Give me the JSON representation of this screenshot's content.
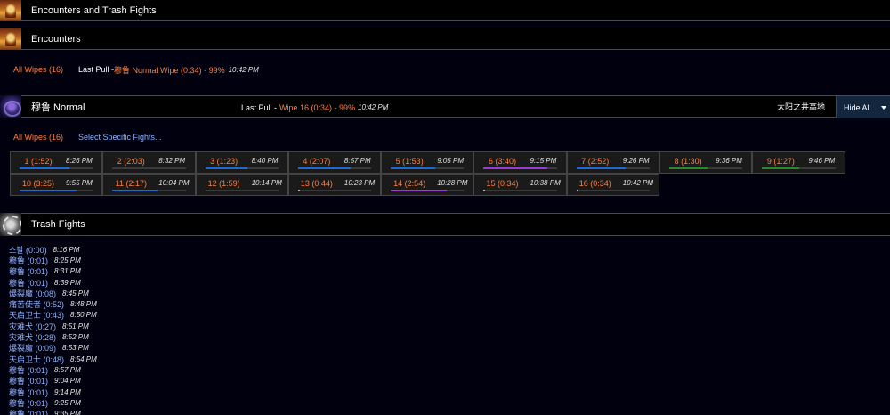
{
  "top_header": {
    "title": "Encounters and Trash Fights"
  },
  "encounters_header": {
    "title": "Encounters"
  },
  "summary": {
    "all_wipes": "All Wipes (16)",
    "last_pull_label": "Last Pull - ",
    "last_pull_value": "穆鲁 Normal Wipe (0:34) - 99%",
    "last_pull_time": "10:42 PM"
  },
  "boss": {
    "title": "穆鲁 Normal",
    "last_pull_label": "Last Pull - ",
    "last_pull_value": "Wipe 16 (0:34) - 99%",
    "last_pull_time": "10:42 PM",
    "zone": "太阳之井高地",
    "hide_all": "Hide All",
    "all_wipes": "All Wipes (16)",
    "select_fights": "Select Specific Fights..."
  },
  "colors": {
    "accent_orange": "#ff7f3f",
    "link_blue": "#8fb3ff",
    "bar_blue": "#1e6ad8",
    "bar_purple": "#9a3ad8",
    "bar_green": "#2a8a2a",
    "bar_gray": "#bdbdbd"
  },
  "fights": [
    {
      "label": "1 (1:52)",
      "time": "8:26 PM",
      "progress": 0.68,
      "color": "#1e6ad8"
    },
    {
      "label": "2 (2:03)",
      "time": "8:32 PM",
      "progress": 0.0,
      "color": "#1e6ad8"
    },
    {
      "label": "3 (1:23)",
      "time": "8:40 PM",
      "progress": 0.58,
      "color": "#1e6ad8"
    },
    {
      "label": "4 (2:07)",
      "time": "8:57 PM",
      "progress": 0.72,
      "color": "#1e6ad8"
    },
    {
      "label": "5 (1:53)",
      "time": "9:05 PM",
      "progress": 0.6,
      "color": "#1e6ad8"
    },
    {
      "label": "6 (3:40)",
      "time": "9:15 PM",
      "progress": 0.87,
      "color": "#9a3ad8"
    },
    {
      "label": "7 (2:52)",
      "time": "9:26 PM",
      "progress": 0.67,
      "color": "#1e6ad8"
    },
    {
      "label": "8 (1:30)",
      "time": "9:36 PM",
      "progress": 0.52,
      "color": "#2a8a2a"
    },
    {
      "label": "9 (1:27)",
      "time": "9:46 PM",
      "progress": 0.5,
      "color": "#2a8a2a"
    },
    {
      "label": "10 (3:25)",
      "time": "9:55 PM",
      "progress": 0.78,
      "color": "#1e6ad8"
    },
    {
      "label": "11 (2:17)",
      "time": "10:04 PM",
      "progress": 0.62,
      "color": "#1e6ad8"
    },
    {
      "label": "12 (1:59)",
      "time": "10:14 PM",
      "progress": 0.0,
      "color": "#1e6ad8"
    },
    {
      "label": "13 (0:44)",
      "time": "10:23 PM",
      "progress": 0.02,
      "color": "#bdbdbd"
    },
    {
      "label": "14 (2:54)",
      "time": "10:28 PM",
      "progress": 0.76,
      "color": "#9a3ad8"
    },
    {
      "label": "15 (0:34)",
      "time": "10:38 PM",
      "progress": 0.02,
      "color": "#bdbdbd"
    },
    {
      "label": "16 (0:34)",
      "time": "10:42 PM",
      "progress": 0.02,
      "color": "#bdbdbd"
    }
  ],
  "trash_header": {
    "title": "Trash Fights"
  },
  "trash": [
    {
      "name": "스팔 (0:00)",
      "time": "8:16 PM"
    },
    {
      "name": "穆鲁 (0:01)",
      "time": "8:25 PM"
    },
    {
      "name": "穆鲁 (0:01)",
      "time": "8:31 PM"
    },
    {
      "name": "穆鲁 (0:01)",
      "time": "8:39 PM"
    },
    {
      "name": "爆裂魔 (0:08)",
      "time": "8:45 PM"
    },
    {
      "name": "痛苦使者 (0:52)",
      "time": "8:48 PM"
    },
    {
      "name": "天启卫士 (0:43)",
      "time": "8:50 PM"
    },
    {
      "name": "灾难犬 (0:27)",
      "time": "8:51 PM"
    },
    {
      "name": "灾难犬 (0:28)",
      "time": "8:52 PM"
    },
    {
      "name": "爆裂魔 (0:09)",
      "time": "8:53 PM"
    },
    {
      "name": "天启卫士 (0:48)",
      "time": "8:54 PM"
    },
    {
      "name": "穆鲁 (0:01)",
      "time": "8:57 PM"
    },
    {
      "name": "穆鲁 (0:01)",
      "time": "9:04 PM"
    },
    {
      "name": "穆鲁 (0:01)",
      "time": "9:14 PM"
    },
    {
      "name": "穆鲁 (0:01)",
      "time": "9:25 PM"
    },
    {
      "name": "穆鲁 (0:01)",
      "time": "9:35 PM"
    }
  ]
}
